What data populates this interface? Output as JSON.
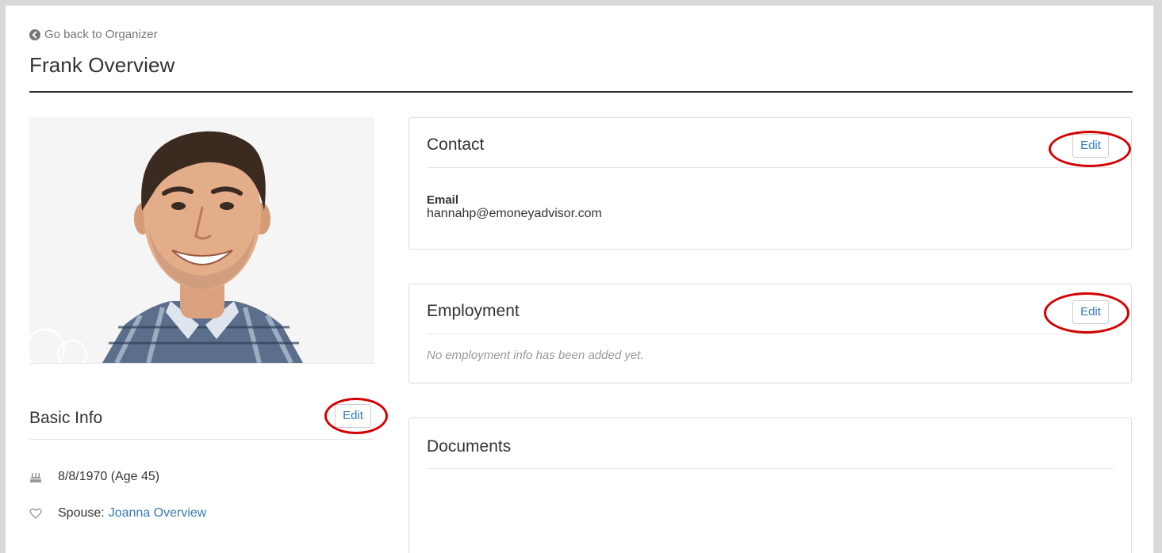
{
  "header": {
    "back_link": "Go back to Organizer",
    "title": "Frank Overview"
  },
  "photo": {
    "alt": "Frank profile photo"
  },
  "basic_info": {
    "title": "Basic Info",
    "edit_label": "Edit",
    "birthdate": "8/8/1970 (Age 45)",
    "spouse_label": "Spouse:",
    "spouse_name": "Joanna Overview"
  },
  "contact": {
    "title": "Contact",
    "edit_label": "Edit",
    "email_label": "Email",
    "email_value": "hannahp@emoneyadvisor.com"
  },
  "employment": {
    "title": "Employment",
    "edit_label": "Edit",
    "empty_message": "No employment info has been added yet."
  },
  "documents": {
    "title": "Documents"
  },
  "colors": {
    "link": "#337ab7",
    "annotation": "#d40000",
    "text": "#333333",
    "muted": "#999999"
  },
  "icons": {
    "back": "circle-arrow-left-icon",
    "birthday": "birthday-cake-icon",
    "spouse": "heart-outline-icon"
  }
}
